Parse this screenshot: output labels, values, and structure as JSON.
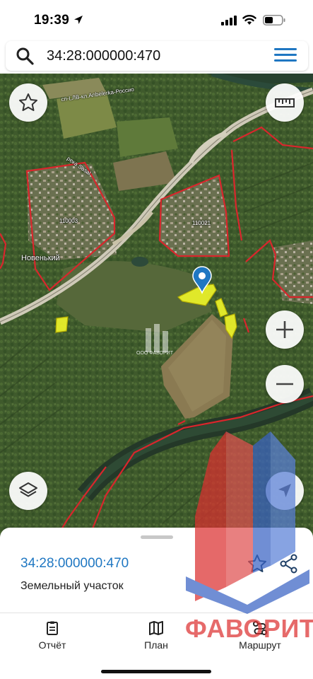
{
  "status_bar": {
    "time": "19:39"
  },
  "search": {
    "query": "34:28:000000:470"
  },
  "map": {
    "labels": {
      "road": "сп-LЛВ-кл.Anbelerka-Россио",
      "river": "река Sasal",
      "block_left": "110003",
      "block_right": "110021",
      "village": "Новенький",
      "watermark_company": "ООО ФАВОРИТ"
    }
  },
  "parcel": {
    "cadastral_number": "34:28:000000:470",
    "type": "Земельный участок"
  },
  "tabs": [
    {
      "label": "Отчёт",
      "icon": "report-icon"
    },
    {
      "label": "План",
      "icon": "map-plan-icon"
    },
    {
      "label": "Маршрут",
      "icon": "route-icon"
    }
  ],
  "watermark": {
    "brand": "ФАВОРИТ"
  },
  "colors": {
    "accent": "#1f77c2",
    "parcel_highlight": "#e8ef2a",
    "boundary": "#d9262c",
    "brand_red": "#dc3030",
    "brand_blue": "#3a63c4"
  }
}
